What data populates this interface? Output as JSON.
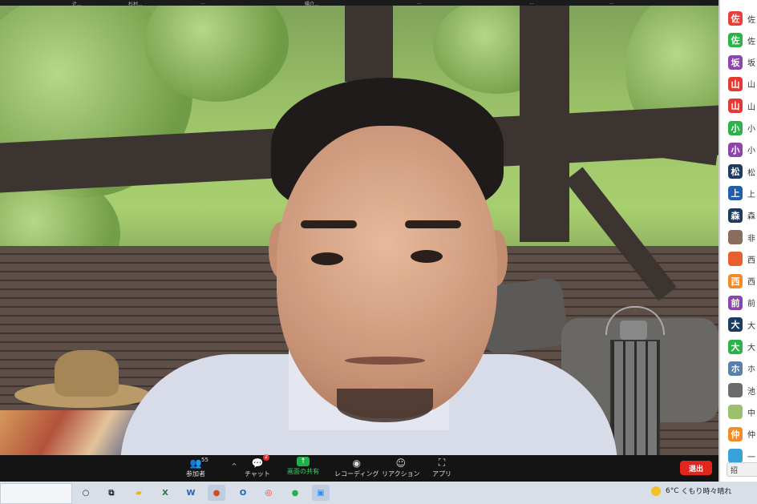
{
  "top_strip": {
    "names": [
      "辻...",
      "杉村...",
      "...",
      "陽介...",
      "...",
      "...",
      "..."
    ]
  },
  "toolbar": {
    "participants": {
      "label": "参加者",
      "count": "55"
    },
    "chat": {
      "label": "チャット",
      "badge": "2"
    },
    "share": {
      "label": "画面の共有"
    },
    "record": {
      "label": "レコーディング"
    },
    "reaction": {
      "label": "リアクション"
    },
    "apps": {
      "label": "アプリ"
    },
    "leave": {
      "label": "退出"
    }
  },
  "participants_panel": {
    "items": [
      {
        "initial": "佐",
        "color": "#e8403a",
        "name": "佐"
      },
      {
        "initial": "佐",
        "color": "#2bb34a",
        "name": "佐"
      },
      {
        "initial": "坂",
        "color": "#8e44ad",
        "name": "坂"
      },
      {
        "initial": "山",
        "color": "#e53935",
        "name": "山"
      },
      {
        "initial": "山",
        "color": "#e53935",
        "name": "山"
      },
      {
        "initial": "小",
        "color": "#2bb34a",
        "name": "小"
      },
      {
        "initial": "小",
        "color": "#8e44ad",
        "name": "小"
      },
      {
        "initial": "松",
        "color": "#1e3a5f",
        "name": "松"
      },
      {
        "initial": "上",
        "color": "#1f5fa8",
        "name": "上"
      },
      {
        "initial": "森",
        "color": "#1e3a5f",
        "name": "森"
      },
      {
        "initial": "",
        "color": "#8a6d5a",
        "name": "非"
      },
      {
        "initial": "",
        "color": "#e8602c",
        "name": "西"
      },
      {
        "initial": "西",
        "color": "#f28c28",
        "name": "西"
      },
      {
        "initial": "前",
        "color": "#8e44ad",
        "name": "前"
      },
      {
        "initial": "大",
        "color": "#1e3a5f",
        "name": "大"
      },
      {
        "initial": "大",
        "color": "#2bb34a",
        "name": "大"
      },
      {
        "initial": "ホ",
        "color": "#5a7fa8",
        "name": "ホ"
      },
      {
        "initial": "",
        "color": "#6b6b6b",
        "name": "池"
      },
      {
        "initial": "",
        "color": "#9bbf6a",
        "name": "中"
      },
      {
        "initial": "仲",
        "color": "#f28c28",
        "name": "仲"
      },
      {
        "initial": "",
        "color": "#3aa0d8",
        "name": "一"
      }
    ],
    "bottom_button": "招"
  },
  "taskbar": {
    "apps": [
      "task-view",
      "file-explorer",
      "excel",
      "word",
      "powerpoint",
      "outlook",
      "chrome",
      "line",
      "zoom"
    ],
    "weather": {
      "temp": "6°C",
      "text": "くもり時々晴れ"
    }
  }
}
